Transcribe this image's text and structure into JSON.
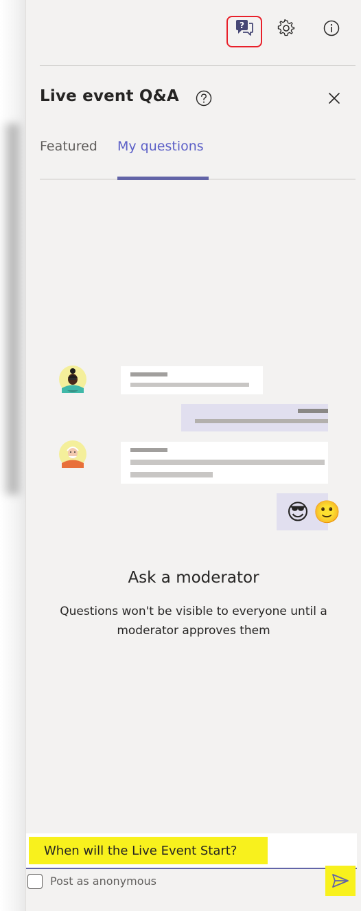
{
  "header": {
    "icons": {
      "qa": "qa-chat-icon",
      "settings": "gear-icon",
      "info": "info-icon"
    }
  },
  "panel": {
    "title": "Live event Q&A",
    "help_icon": "question-circle-icon",
    "close_icon": "close-icon"
  },
  "tabs": [
    {
      "label": "Featured",
      "active": false
    },
    {
      "label": "My questions",
      "active": true
    }
  ],
  "empty_state": {
    "title": "Ask a moderator",
    "subtitle": "Questions won't be visible to everyone until a moderator approves them",
    "emoji": [
      "😎",
      "🙂"
    ]
  },
  "composer": {
    "value": "When will the Live Event Start?",
    "anonymous_label": "Post as anonymous",
    "anonymous_checked": false,
    "send_icon": "send-icon"
  },
  "colors": {
    "accent": "#6264a7",
    "highlight": "#f8f11d",
    "annotation": "#e8202a",
    "panel_bg": "#f3f2f1"
  }
}
